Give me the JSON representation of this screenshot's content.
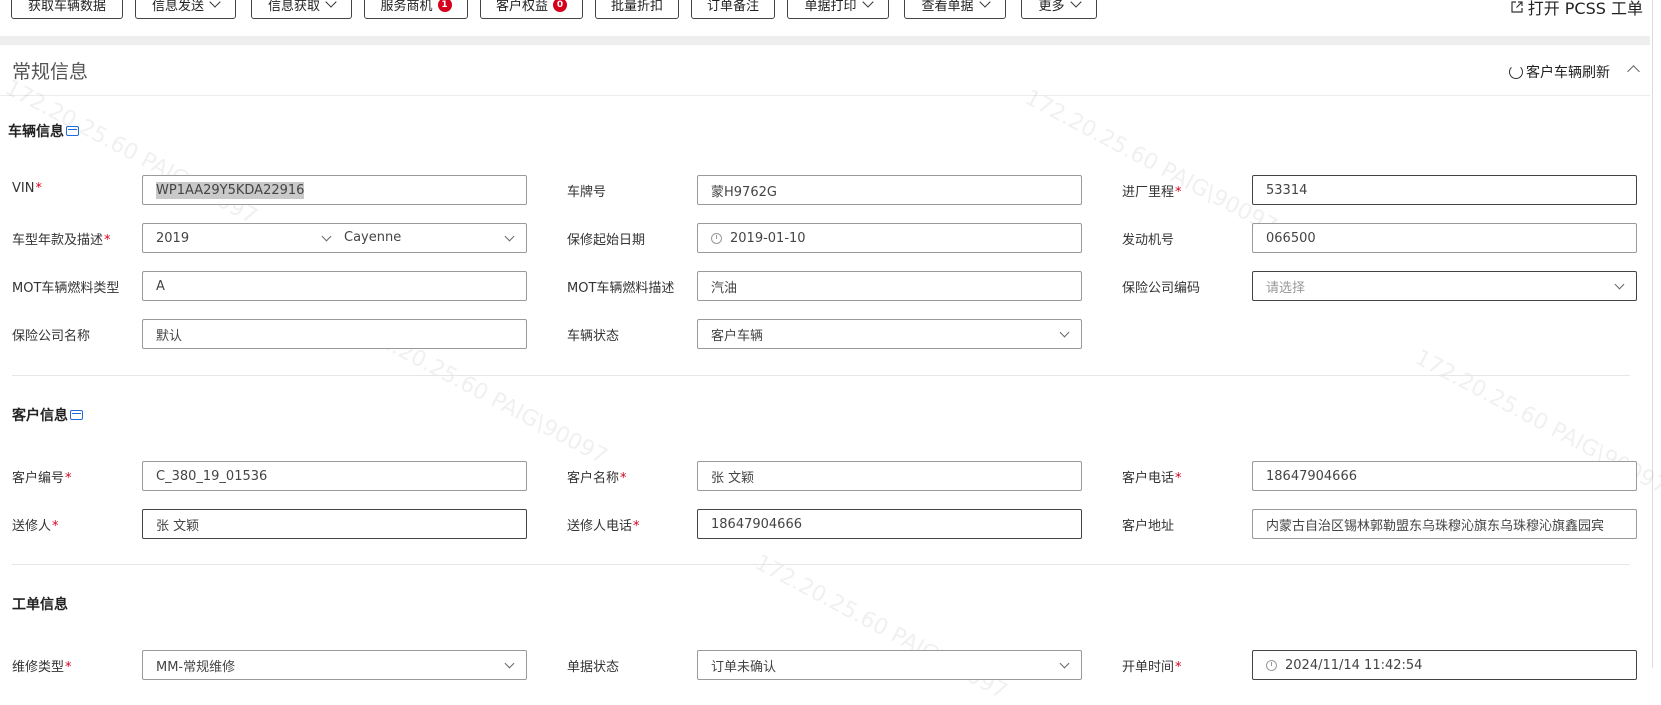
{
  "toolbar": {
    "buttons": [
      {
        "label": "获取车辆数据"
      },
      {
        "label": "信息发送"
      },
      {
        "label": "信息获取"
      },
      {
        "label": "服务商机",
        "badge": "1"
      },
      {
        "label": "客户权益",
        "badge": "0"
      },
      {
        "label": "批量折扣"
      },
      {
        "label": "订单备注"
      },
      {
        "label": "单据打印"
      },
      {
        "label": "查看单据"
      },
      {
        "label": "更多"
      }
    ],
    "open_pcss": "打开 PCSS 工单"
  },
  "section": {
    "title": "常规信息",
    "refresh_label": "客户车辆刷新"
  },
  "vehicle": {
    "title": "车辆信息",
    "vin_label": "VIN",
    "vin_value": "WP1AA29Y5KDA22916",
    "plate_label": "车牌号",
    "plate_value": "蒙H9762G",
    "mileage_label": "进厂里程",
    "mileage_value": "53314",
    "model_label": "车型年款及描述",
    "model_year": "2019",
    "model_desc": "Cayenne",
    "warranty_label": "保修起始日期",
    "warranty_value": "2019-01-10",
    "engine_label": "发动机号",
    "engine_value": "066500",
    "mot_type_label": "MOT车辆燃料类型",
    "mot_type_value": "A",
    "mot_desc_label": "MOT车辆燃料描述",
    "mot_desc_value": "汽油",
    "ins_code_label": "保险公司编码",
    "ins_code_placeholder": "请选择",
    "ins_name_label": "保险公司名称",
    "ins_name_value": "默认",
    "status_label": "车辆状态",
    "status_value": "客户车辆"
  },
  "customer": {
    "title": "客户信息",
    "id_label": "客户编号",
    "id_value": "C_380_19_01536",
    "name_label": "客户名称",
    "name_value": "张 文颖",
    "phone_label": "客户电话",
    "phone_value": "18647904666",
    "sender_label": "送修人",
    "sender_value": "张 文颖",
    "sender_phone_label": "送修人电话",
    "sender_phone_value": "18647904666",
    "address_label": "客户地址",
    "address_value": "内蒙古自治区锡林郭勒盟东乌珠穆沁旗东乌珠穆沁旗鑫园宾"
  },
  "order": {
    "title": "工单信息",
    "repair_type_label": "维修类型",
    "repair_type_value": "MM-常规维修",
    "doc_status_label": "单据状态",
    "doc_status_value": "订单未确认",
    "open_time_label": "开单时间",
    "open_time_value": "2024/11/14 11:42:54"
  },
  "watermark": "172.20.25.60  PAIG\\90097"
}
